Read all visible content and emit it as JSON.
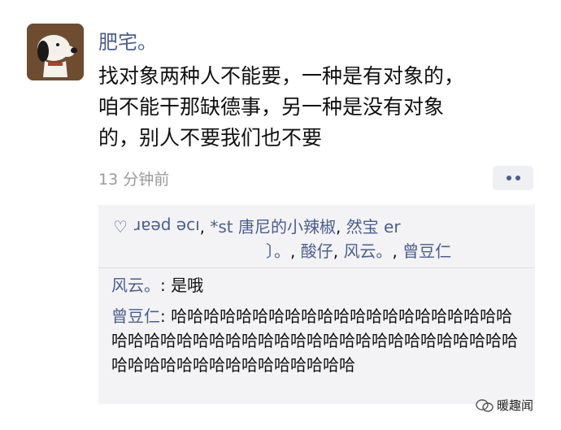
{
  "post": {
    "author": "肥宅。",
    "text": "找对象两种人不能要，一种是有对象的，\n咱不能干那缺德事，另一种是没有对象\n的，别人不要我们也不要",
    "timestamp": "13 分钟前"
  },
  "likes": {
    "names": [
      "ıɔe pear",
      "*st 唐尼的小辣椒",
      "然宝 er",
      "〕。",
      "酸仔",
      "风云。",
      "曾豆仁"
    ]
  },
  "comments": [
    {
      "author": "风云。",
      "text": "是哦"
    },
    {
      "author": "曾豆仁",
      "text": "哈哈哈哈哈哈哈哈哈哈哈哈哈哈哈哈哈哈哈哈哈哈哈哈哈哈哈哈哈哈哈哈哈哈哈哈哈哈哈哈哈哈哈哈哈哈哈哈哈哈哈哈哈哈哈哈哈哈哈哈哈"
    }
  ],
  "watermark": "暖趣闻",
  "icons": [
    "heart-icon",
    "more-icon",
    "wechat-icon"
  ],
  "colors": {
    "link": "#4a5e8f",
    "panel": "#f3f3f5",
    "muted": "#9a9a9a"
  }
}
